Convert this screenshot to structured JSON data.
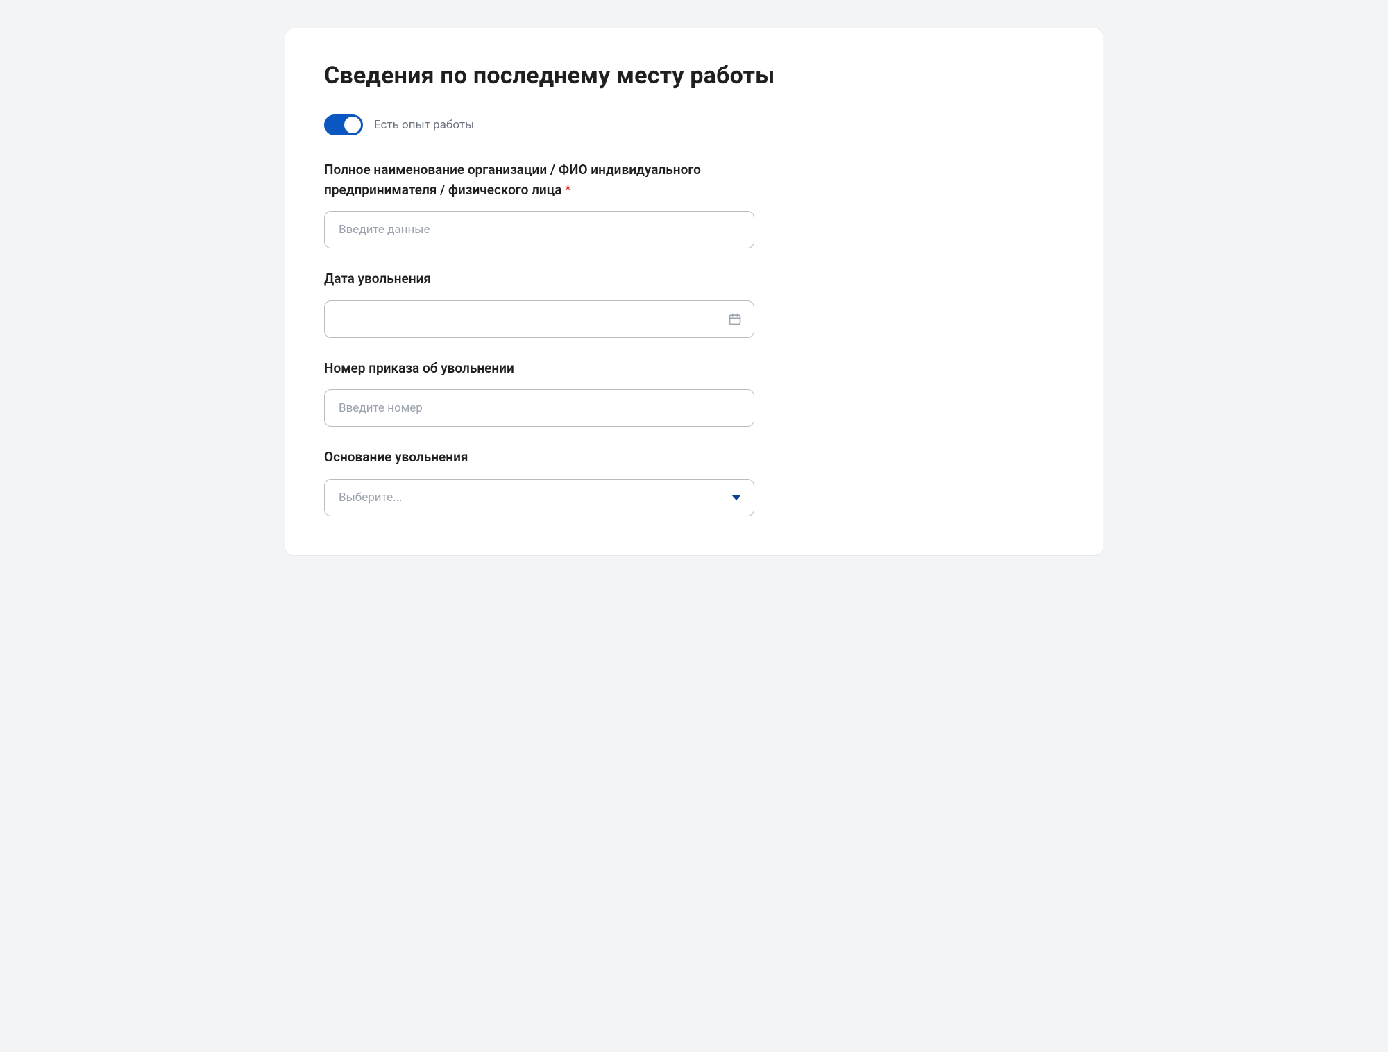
{
  "form": {
    "title": "Сведения по последнему месту работы",
    "toggle": {
      "label": "Есть опыт работы",
      "checked": true
    },
    "fields": {
      "org_name": {
        "label": "Полное наименование организации / ФИО индивидуального предпринимателя / физического лица",
        "required_mark": "*",
        "placeholder": "Введите данные"
      },
      "dismissal_date": {
        "label": "Дата увольнения",
        "placeholder": ""
      },
      "order_number": {
        "label": "Номер приказа об увольнении",
        "placeholder": "Введите номер"
      },
      "dismissal_reason": {
        "label": "Основание увольнения",
        "placeholder": "Выберите..."
      }
    }
  }
}
